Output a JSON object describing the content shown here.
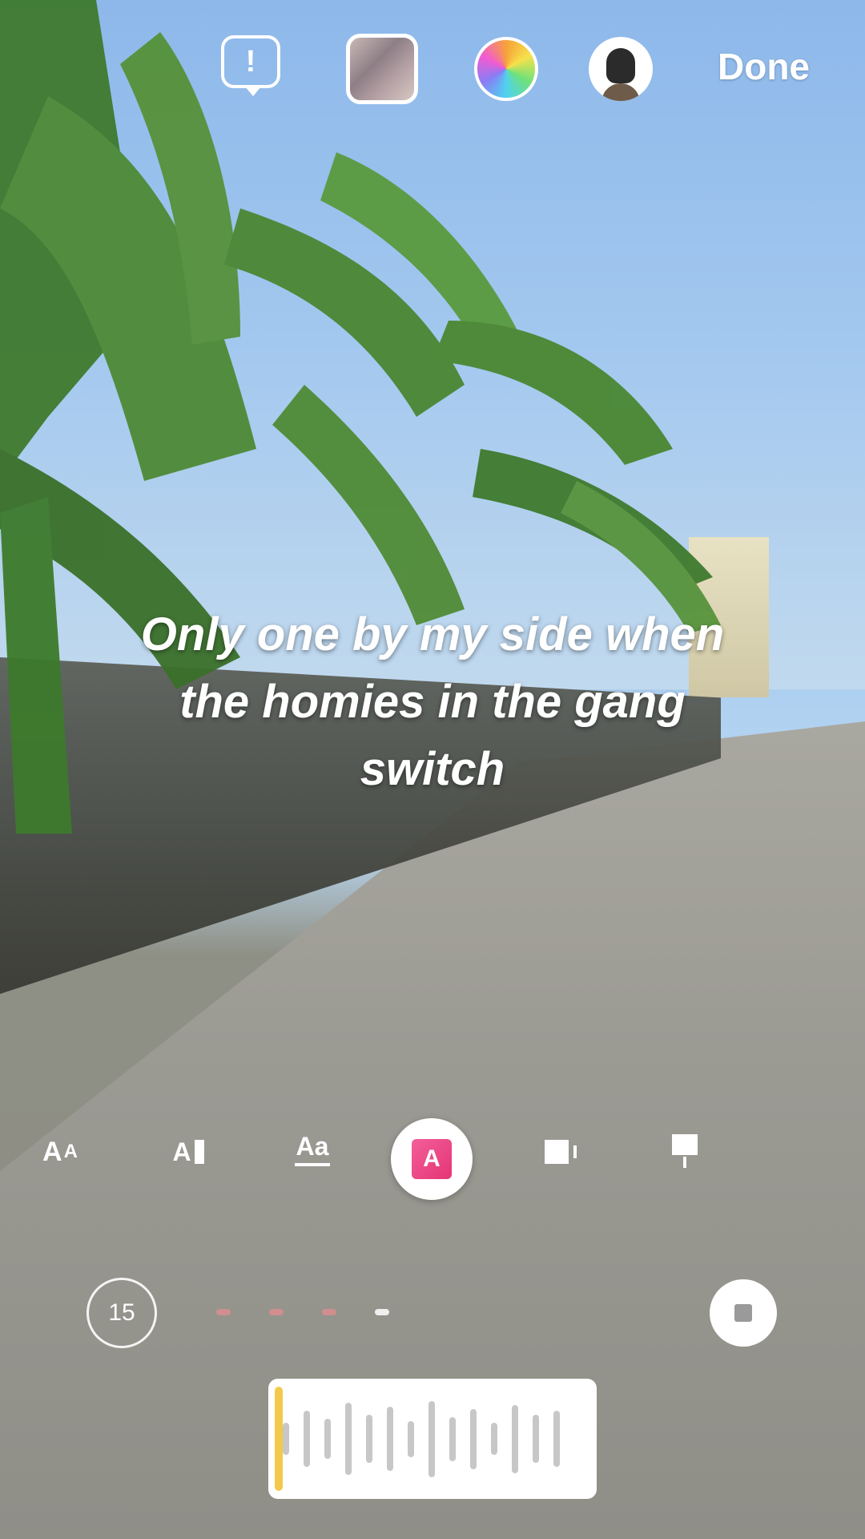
{
  "top_bar": {
    "done_label": "Done",
    "alert_glyph": "!"
  },
  "caption": {
    "line1": "Only one by my side when",
    "line2": "the homies in the gang",
    "line3": "switch"
  },
  "style_bar": {
    "aa_label": "A",
    "aa_small": "A",
    "abox_label": "A",
    "aline_label": "Aa",
    "selected_label": "A"
  },
  "duration": {
    "seconds": "15"
  },
  "icons": {
    "sticker": "sticker-alert-icon",
    "media": "media-thumbnail",
    "color": "color-wheel-icon",
    "avatar": "avatar-icon",
    "stop": "stop-icon"
  },
  "colors": {
    "selected_style": "#e53575",
    "scrubber_handle": "#f2c94c"
  }
}
